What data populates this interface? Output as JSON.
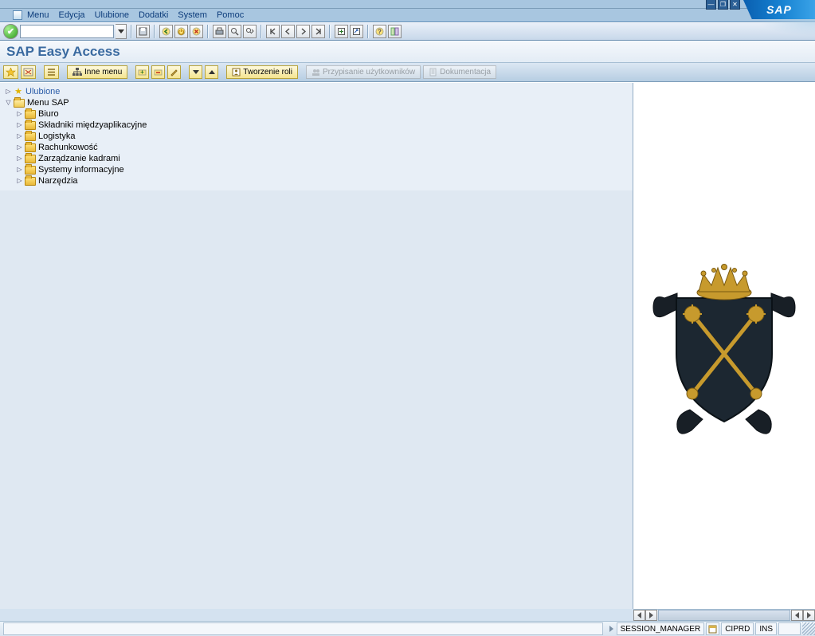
{
  "menubar": {
    "items": [
      "Menu",
      "Edycja",
      "Ulubione",
      "Dodatki",
      "System",
      "Pomoc"
    ]
  },
  "header": {
    "title": "SAP Easy Access"
  },
  "toolbar": {
    "cmd_value": ""
  },
  "apptoolbar": {
    "other_menu": "Inne menu",
    "create_role": "Tworzenie roli",
    "assign_users": "Przypisanie użytkowników",
    "documentation": "Dokumentacja"
  },
  "tree": {
    "favorites_label": "Ulubione",
    "root_label": "Menu SAP",
    "children": [
      {
        "label": "Biuro"
      },
      {
        "label": "Składniki międzyaplikacyjne"
      },
      {
        "label": "Logistyka"
      },
      {
        "label": "Rachunkowość"
      },
      {
        "label": "Zarządzanie kadrami"
      },
      {
        "label": "Systemy informacyjne"
      },
      {
        "label": "Narzędzia"
      }
    ]
  },
  "statusbar": {
    "transaction": "SESSION_MANAGER",
    "system": "CIPRD",
    "mode": "INS"
  }
}
